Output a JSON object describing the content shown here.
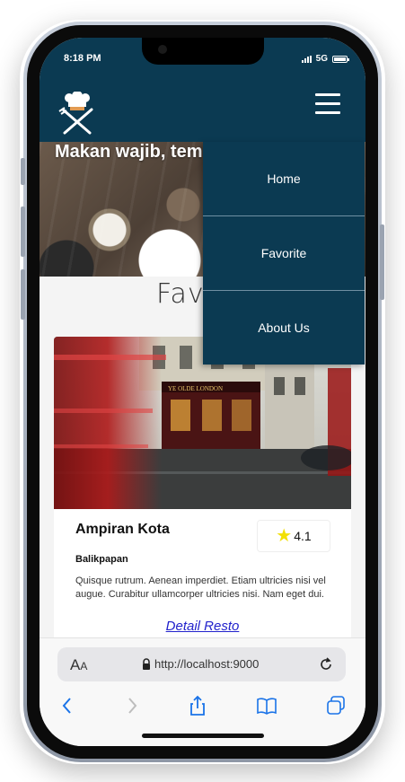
{
  "status": {
    "time": "8:18 PM",
    "network": "5G"
  },
  "app": {
    "logo_icon": "chef-hat-utensils-icon",
    "menu_icon": "hamburger-icon",
    "colors": {
      "primary": "#0b3a52",
      "link": "#2222cc",
      "star": "#f2e006"
    }
  },
  "hero": {
    "title": "Makan wajib, tem"
  },
  "main": {
    "section_title": "Favo"
  },
  "nav": {
    "items": [
      {
        "label": "Home"
      },
      {
        "label": "Favorite"
      },
      {
        "label": "About Us"
      }
    ]
  },
  "restaurant": {
    "name": "Ampiran Kota",
    "rating": "4.1",
    "city": "Balikpapan",
    "description": "Quisque rutrum. Aenean imperdiet. Etiam ultricies nisi vel augue. Curabitur ullamcorper ultricies nisi. Nam eget dui.",
    "detail_link": "Detail Resto",
    "image_sign": "YE OLDE LONDON"
  },
  "browser": {
    "aa_label_large": "A",
    "aa_label_small": "A",
    "url": "http://localhost:9000",
    "icons": [
      "lock-icon",
      "reload-icon",
      "back-icon",
      "forward-icon",
      "share-icon",
      "bookmarks-icon",
      "tabs-icon"
    ]
  }
}
